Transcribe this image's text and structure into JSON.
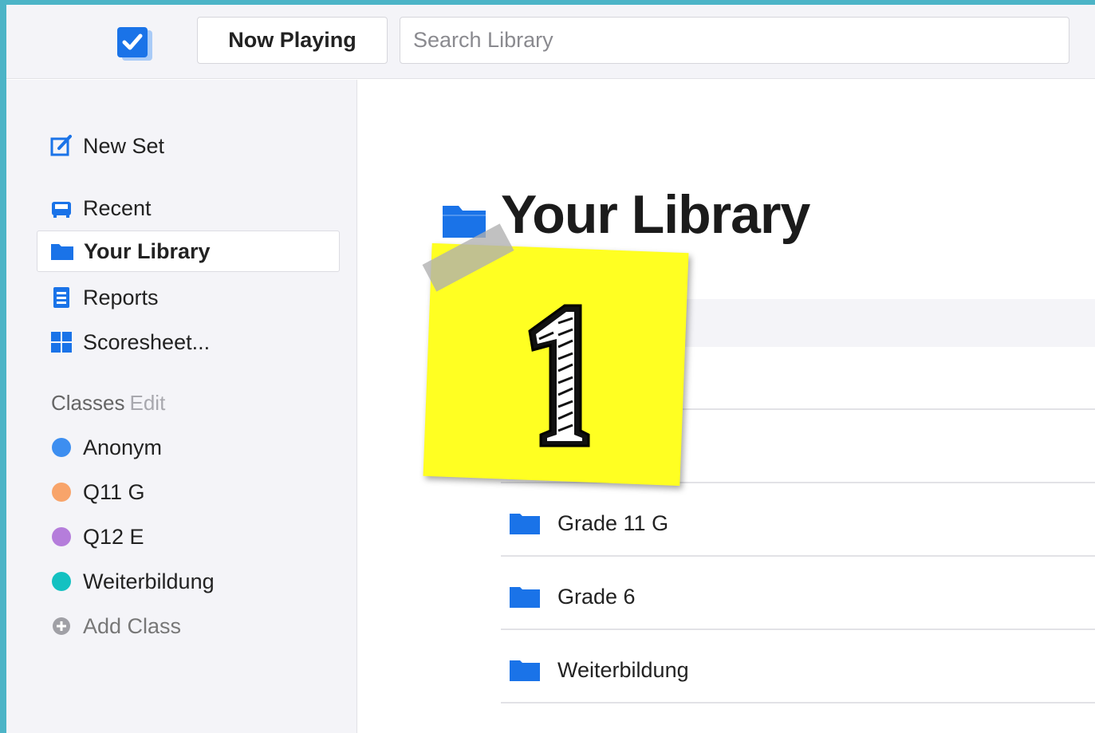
{
  "topbar": {
    "now_playing_label": "Now Playing",
    "search_placeholder": "Search Library"
  },
  "sidebar": {
    "new_set": "New Set",
    "recent": "Recent",
    "your_library": "Your Library",
    "reports": "Reports",
    "scoresheet": "Scoresheet...",
    "classes_label": "Classes",
    "classes_edit": "Edit",
    "classes": [
      {
        "label": "Anonym",
        "color": "#3d8ef0"
      },
      {
        "label": "Q11 G",
        "color": "#f8a46a"
      },
      {
        "label": "Q12 E",
        "color": "#b57ddb"
      },
      {
        "label": "Weiterbildung",
        "color": "#14c1c1"
      }
    ],
    "add_class": "Add Class"
  },
  "main": {
    "title": "Your Library",
    "folders": [
      {
        "label": "Grade 11 G"
      },
      {
        "label": "Grade 6"
      },
      {
        "label": "Weiterbildung"
      }
    ]
  },
  "colors": {
    "accent_blue": "#1a73e8",
    "sidebar_bg": "#f4f4f8",
    "sticky_note": "#ffff22",
    "frame": "#4cb4c7"
  }
}
